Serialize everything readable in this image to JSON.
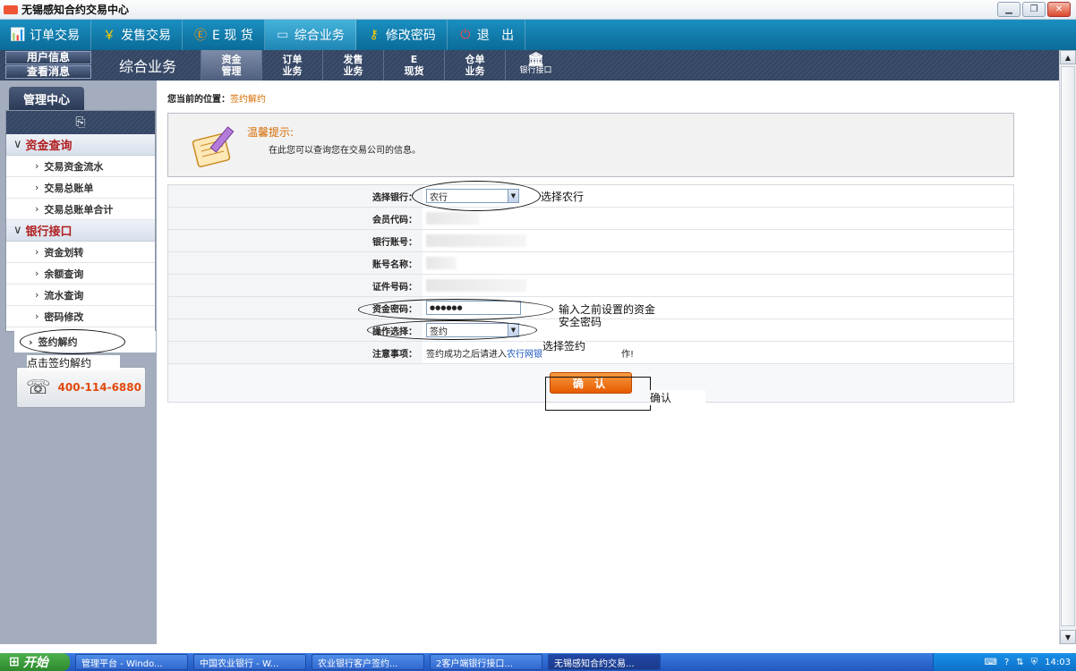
{
  "window": {
    "title": "无锡感知合约交易中心"
  },
  "topnav": [
    {
      "label": "订单交易",
      "icon": "bar-chart-icon",
      "glyph": "📊"
    },
    {
      "label": "发售交易",
      "icon": "yen-icon",
      "glyph": "￥"
    },
    {
      "label": "E 现 货",
      "icon": "e-circle-icon",
      "glyph": "Ⓔ"
    },
    {
      "label": "综合业务",
      "icon": "monitor-icon",
      "glyph": "▭"
    },
    {
      "label": "修改密码",
      "icon": "key-icon",
      "glyph": "⚷"
    },
    {
      "label": "退   出",
      "icon": "power-icon",
      "glyph": "⏻"
    }
  ],
  "subhead": {
    "quick": [
      "用户信息",
      "查看消息"
    ],
    "section_title": "综合业务",
    "modules": [
      {
        "line1": "资金",
        "line2": "管理"
      },
      {
        "line1": "订单",
        "line2": "业务"
      },
      {
        "line1": "发售",
        "line2": "业务"
      },
      {
        "line1": "E",
        "line2": "现货"
      },
      {
        "line1": "仓单",
        "line2": "业务"
      },
      {
        "line1": "银行接口"
      }
    ]
  },
  "sidebar": {
    "tab": "管理中心",
    "groups": [
      {
        "label": "资金查询",
        "items": [
          "交易资金流水",
          "交易总账单",
          "交易总账单合计"
        ]
      },
      {
        "label": "银行接口",
        "items": [
          "资金划转",
          "余额查询",
          "流水查询",
          "密码修改"
        ]
      }
    ],
    "active_item": "签约解约",
    "phone": "400-114-6880"
  },
  "main": {
    "breadcrumb_label": "您当前的位置：",
    "breadcrumb_current": "签约解约",
    "tip_title": "温馨提示:",
    "tip_text": "在此您可以查询您在交易公司的信息。",
    "form": {
      "bank_label": "选择银行：",
      "bank_value": "农行",
      "member_label": "会员代码：",
      "account_label": "银行账号：",
      "name_label": "账号名称：",
      "id_label": "证件号码：",
      "pwd_label": "资金密码：",
      "pwd_value": "●●●●●●",
      "op_label": "操作选择：",
      "op_value": "签约",
      "note_label": "注意事项：",
      "note_prefix": "签约成功之后请进入",
      "note_link": "农行网银",
      "note_suffix": "作!",
      "confirm": "确 认"
    }
  },
  "annotations": {
    "bank": "选择农行",
    "pwd": "输入之前设置的资金安全密码",
    "op": "选择签约",
    "sidebar": "点击签约解约",
    "confirm": "确认"
  },
  "taskbar": {
    "start": "开始",
    "tasks": [
      "管理平台 - Windo...",
      "中国农业银行 - W...",
      "农业银行客户签约...",
      "2客户端银行接口...",
      "无锡感知合约交易..."
    ],
    "time": "14:03"
  }
}
